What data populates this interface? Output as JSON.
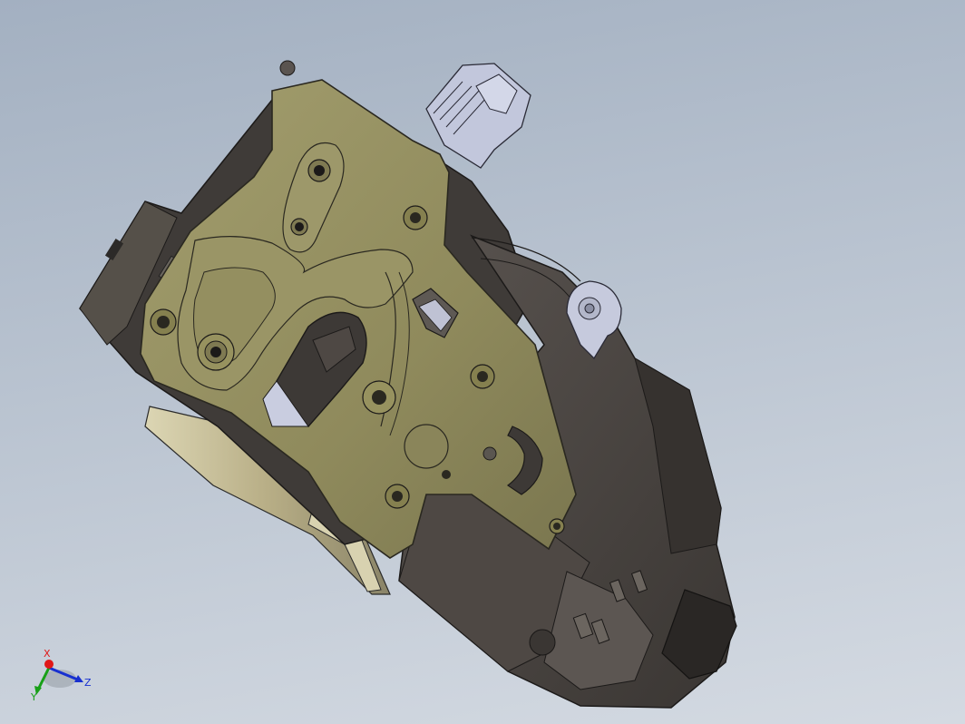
{
  "viewport": {
    "background_top": "#a3b0c1",
    "background_bottom": "#d4dae2"
  },
  "model": {
    "plate_color": "#8f8a5c",
    "housing_color": "#4a4541",
    "bracket_color": "#c4c9de",
    "lever_color": "#c9c09a"
  },
  "triad": {
    "x_label": "X",
    "y_label": "Y",
    "z_label": "Z",
    "x_color": "#e01818",
    "y_color": "#18a018",
    "z_color": "#1830d0"
  }
}
